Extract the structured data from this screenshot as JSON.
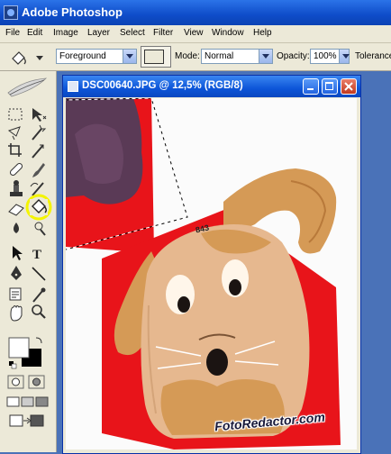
{
  "app": {
    "title": "Adobe Photoshop"
  },
  "menu": [
    "File",
    "Edit",
    "Image",
    "Layer",
    "Select",
    "Filter",
    "View",
    "Window",
    "Help"
  ],
  "options": {
    "fill_source": "Foreground",
    "mode_label": "Mode:",
    "mode_value": "Normal",
    "opacity_label": "Opacity:",
    "opacity_value": "100%",
    "tolerance_label": "Tolerance"
  },
  "document": {
    "title": "DSC00640.JPG @ 12,5% (RGB/8)",
    "tag_number": "843"
  },
  "watermark": "FotoRedactor.com",
  "colors": {
    "title_blue": "#0e4cc9",
    "highlight": "#f4f400",
    "background_red": "#e8141a",
    "toy_beige": "#e6b88f"
  },
  "toolbox": {
    "icons": [
      "marquee-icon",
      "move-icon",
      "lasso-icon",
      "magic-wand-icon",
      "crop-icon",
      "slice-icon",
      "healing-icon",
      "brush-icon",
      "stamp-icon",
      "history-brush-icon",
      "eraser-icon",
      "paint-bucket-icon",
      "blur-icon",
      "dodge-icon",
      "path-select-icon",
      "type-icon",
      "pen-icon",
      "line-icon",
      "notes-icon",
      "eyedropper-icon",
      "hand-icon",
      "zoom-icon",
      "foreground-color-icon",
      "background-color-icon",
      "quick-mask-icon",
      "screen-mode-icon",
      "jump-to-imageready-icon"
    ]
  }
}
